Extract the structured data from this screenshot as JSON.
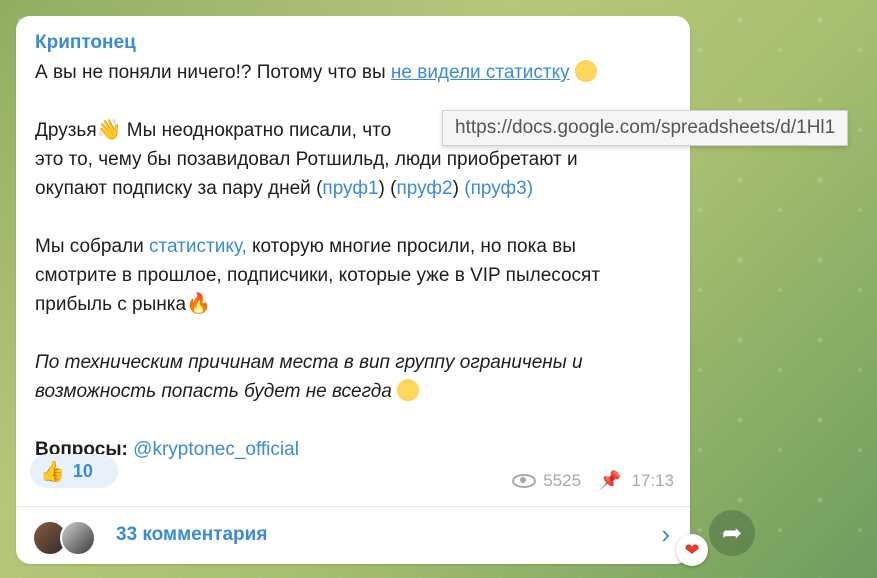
{
  "message": {
    "author": "Криптонец",
    "line1_text": "А вы не поняли ничего!? Потому что вы ",
    "line1_link": "не видели статистку",
    "line2_text": "Друзья",
    "line2_rest": " Мы неоднократно писали, что ",
    "line3_text": "это то, чему бы позавидовал Ротшильд, люди приобретают и",
    "line4_text": "окупают подписку за пару дней (",
    "proof1": "пруф1",
    "proof2": "пруф2",
    "proof3": "пруф3",
    "line5_text": "Мы собрали ",
    "line5_link": "статистику,",
    "line5_rest": " которую многие просили, но пока вы",
    "line6_text": "смотрите в прошлое, подписчики, которые уже в VIP пылесосят",
    "line7_text": "прибыль с рынка",
    "italic1": "По техническим причинам места в вип группу ограничены и",
    "italic2": "возможность попасть будет не всегда",
    "questions_label": "Вопросы:",
    "questions_link": "@kryptonec_official"
  },
  "reaction": {
    "icon": "thumbs-up",
    "count": "10"
  },
  "meta": {
    "views": "5525",
    "time": "17:13"
  },
  "comments": {
    "label": "33 комментария"
  },
  "tooltip": {
    "url": "https://docs.google.com/spreadsheets/d/1Hl1"
  },
  "colors": {
    "accent": "#3a8bd6",
    "bubble": "#ffffff",
    "heart": "#e53935"
  }
}
